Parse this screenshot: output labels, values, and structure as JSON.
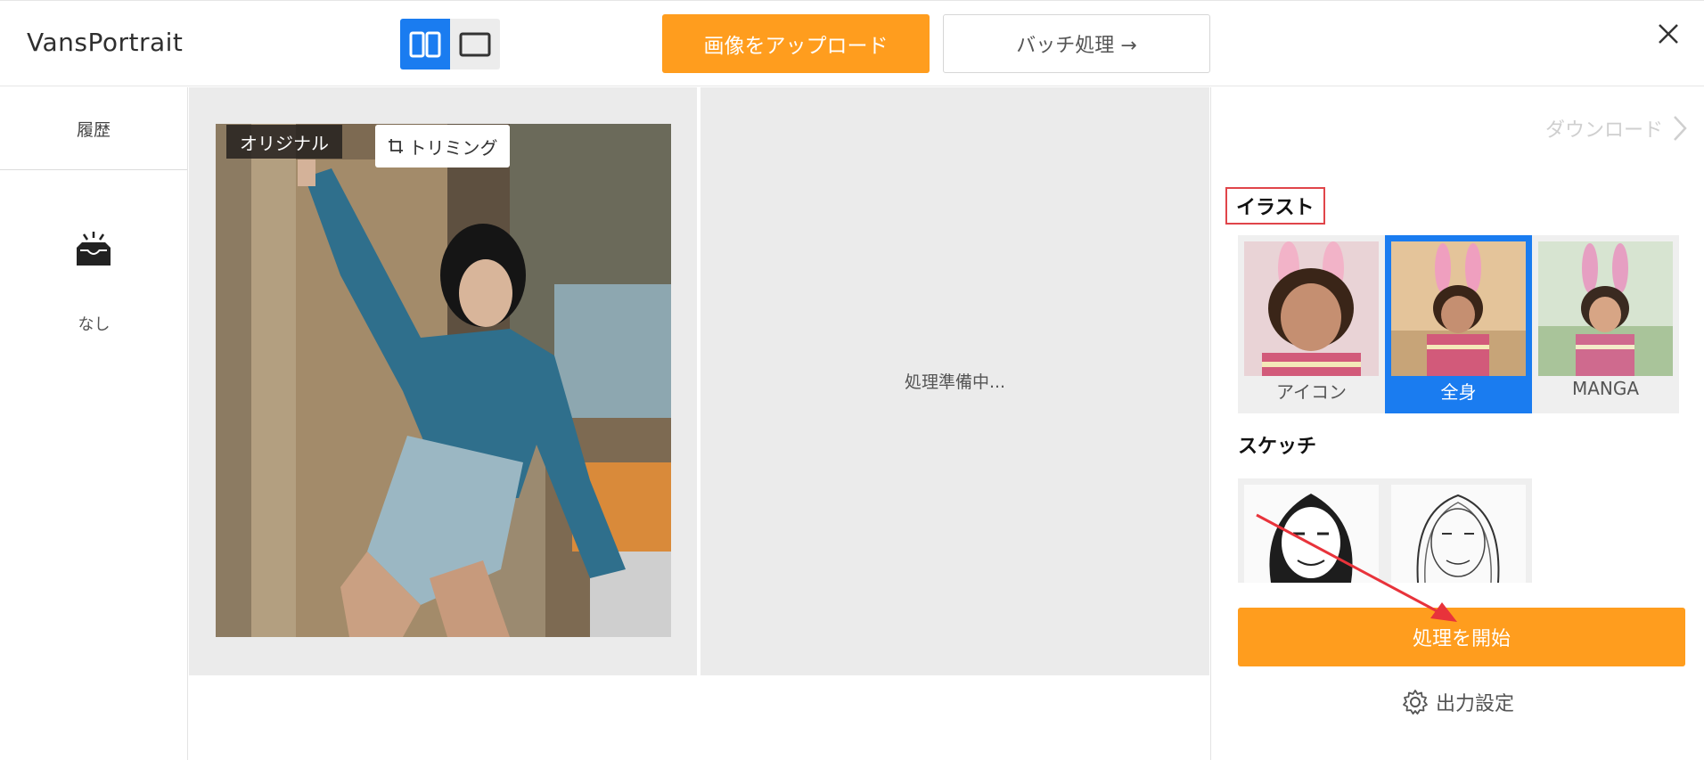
{
  "app": {
    "name": "VansPortrait"
  },
  "header": {
    "upload_label": "画像をアップロード",
    "batch_label": "バッチ処理 →"
  },
  "sidebar": {
    "title": "履歴",
    "empty_text": "なし"
  },
  "preview": {
    "original_label": "オリジナル",
    "trim_label": "トリミング",
    "processing_text": "処理準備中..."
  },
  "panel": {
    "download_label": "ダウンロード",
    "illust_title": "イラスト",
    "illust_styles": [
      {
        "label": "アイコン",
        "selected": false
      },
      {
        "label": "全身",
        "selected": true
      },
      {
        "label": "MANGA",
        "selected": false
      }
    ],
    "sketch_title": "スケッチ",
    "start_label": "処理を開始",
    "settings_label": "出力設定"
  },
  "colors": {
    "accent_orange": "#ff9d1e",
    "accent_blue": "#1a7cf0",
    "highlight_red": "#e0454a"
  }
}
